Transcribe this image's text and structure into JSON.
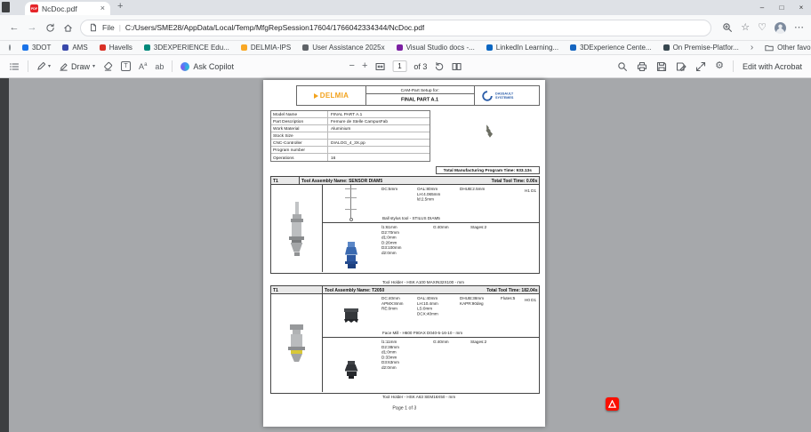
{
  "icons": {
    "back": "←",
    "forward": "→",
    "minimize": "–",
    "maximize": "□",
    "close": "×",
    "tab_close": "×",
    "new_tab": "+",
    "star": "☆",
    "heart": "♡",
    "more": "⋯",
    "gear": "⚙",
    "caret": "▾",
    "chevron": "›",
    "minus": "−",
    "plus": "+",
    "pdf_badge": "PDF",
    "text_tool": "T",
    "read_aloud": "A",
    "read_aloud_sup": "a",
    "ab_tool": "ab",
    "url_divider": "|"
  },
  "window": {
    "tab_title": "NcDoc.pdf"
  },
  "address_bar": {
    "scheme": "File",
    "url": "C:/Users/SME28/AppData/Local/Temp/MfgRepSession17604/1766042334344/NcDoc.pdf"
  },
  "bookmarks": {
    "items": [
      {
        "label": "3DOT",
        "color": "#1a73e8"
      },
      {
        "label": "AMS",
        "color": "#3949ab"
      },
      {
        "label": "Havells",
        "color": "#d93025"
      },
      {
        "label": "3DEXPERIENCE Edu...",
        "color": "#00897b"
      },
      {
        "label": "DELMIA-IPS",
        "color": "#f9a825"
      },
      {
        "label": "User Assistance 2025x",
        "color": "#5f6368"
      },
      {
        "label": "Visual Studio docs -...",
        "color": "#7b1fa2"
      },
      {
        "label": "LinkedIn Learning...",
        "color": "#0a66c2"
      },
      {
        "label": "3DExperience Cente...",
        "color": "#1565c0"
      },
      {
        "label": "On Premise-Platfor...",
        "color": "#37474f"
      }
    ],
    "other_label": "Other favorites"
  },
  "pdf_toolbar": {
    "draw_label": "Draw",
    "copilot_label": "Ask Copilot",
    "page_current": "1",
    "page_total": "of 3",
    "edit_label": "Edit with Acrobat"
  },
  "doc": {
    "brand_left": "DELMIA",
    "setup_label": "CAM-Part Setup for:",
    "part_title": "FINAL PART A.1",
    "brand_right_1": "DASSAULT",
    "brand_right_2": "SYSTEMES",
    "info_rows": [
      {
        "label": "Model Name",
        "value": "FINAL PART A.1"
      },
      {
        "label": "Part Description",
        "value": "Femure de Stelle CampusFab"
      },
      {
        "label": "Work Material",
        "value": "Aluminium"
      },
      {
        "label": "Stock Size",
        "value": ""
      },
      {
        "label": "CNC-Controller",
        "value": "DIALOG_4_3X.pp"
      },
      {
        "label": "Program number",
        "value": ""
      },
      {
        "label": "Operations",
        "value": "16"
      }
    ],
    "total_time": "Total Manufacturing Program Time: 933.13s",
    "tools": [
      {
        "id": "T1",
        "name": "Tool Assembly Name: SENSOR DIAM5",
        "time": "Total Tool Time: 0.00s",
        "cutter": {
          "c1": [
            "DC:5mm"
          ],
          "c2": [
            "OAL:80mm",
            "LH:4.065mm",
            "ld:2.5mm"
          ],
          "c3": [
            "DHUB:2.5mm"
          ],
          "c4": [],
          "c5": [
            "H1 D1"
          ],
          "caption": "Ball stylus tool - STILUS DIAM5"
        },
        "holder": {
          "c1": [
            "l1:61mm",
            "D2:70mm",
            "d1:0mm",
            "D:26mm",
            "D3:100mm",
            "d2:0mm"
          ],
          "c2": [
            "G:40mm"
          ],
          "c3": [
            "Stages:2"
          ],
          "caption": "Tool Holder - HSK A100 MAXIN32X100 - mm"
        }
      },
      {
        "id": "T1",
        "name": "Tool Assembly Name: T2050",
        "time": "Total Tool Time: 182.04s",
        "cutter": {
          "c1": [
            "DC:40mm",
            "APMX:8mm",
            "RE:0mm"
          ],
          "c2": [
            "OAL:40mm",
            "LH:10.4mm",
            "LS:0mm",
            "DCX:40mm"
          ],
          "c3": [
            "DHUB:38mm",
            "KAPR:90deg"
          ],
          "c4": [
            "Flutes:5"
          ],
          "c5": [
            "H0 D1"
          ],
          "caption": "Face Mill - H600 F90AX D040-5-16-10 - mm"
        },
        "holder": {
          "c1": [
            "l1:11mm",
            "D2:38mm",
            "d1:0mm",
            "D:33mm",
            "D3:63mm",
            "d2:0mm"
          ],
          "c2": [
            "G:40mm"
          ],
          "c3": [
            "Stages:2"
          ],
          "caption": "Tool Holder - HSK A63 SEM16X50 - mm"
        }
      }
    ],
    "footer": "Page 1 of 3"
  },
  "colors": {
    "delmia": "#f2a31e",
    "ds_blue": "#2a5ca8"
  }
}
